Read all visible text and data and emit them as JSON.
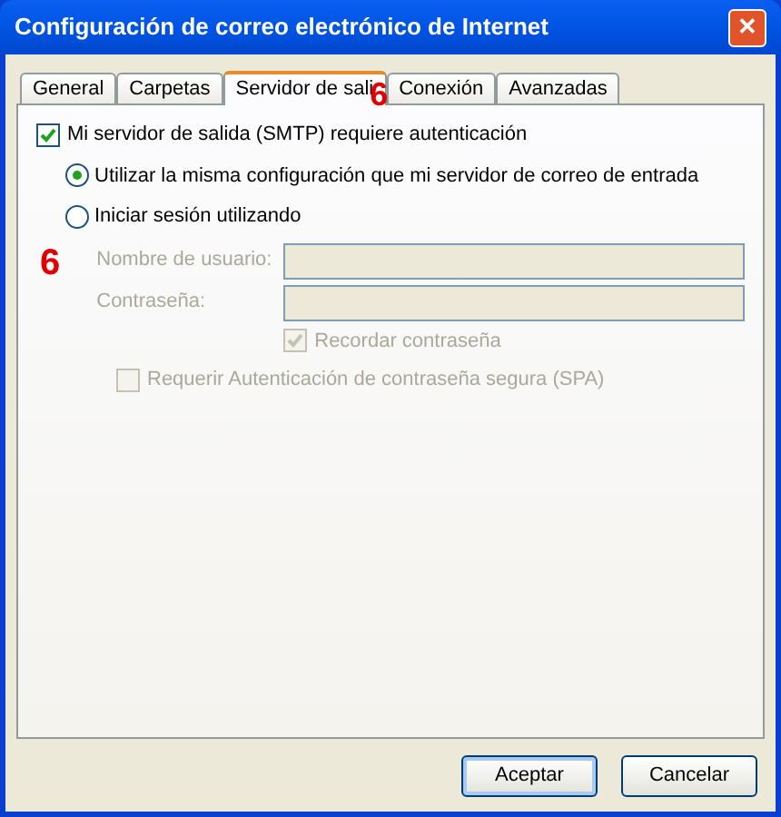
{
  "window": {
    "title": "Configuración de correo electrónico de Internet",
    "close": "✕"
  },
  "tabs": [
    {
      "label": "General",
      "selected": false
    },
    {
      "label": "Carpetas",
      "selected": false
    },
    {
      "label": "Servidor de sali",
      "selected": true,
      "annotation": "6"
    },
    {
      "label": "Conexión",
      "selected": false
    },
    {
      "label": "Avanzadas",
      "selected": false
    }
  ],
  "smtp_auth": {
    "label": "Mi servidor de salida (SMTP) requiere autenticación",
    "checked": true
  },
  "options": [
    {
      "label": "Utilizar la misma configuración que mi servidor de correo de entrada",
      "selected": true
    },
    {
      "label": "Iniciar sesión utilizando",
      "selected": false
    }
  ],
  "annotation": "6",
  "fields": [
    {
      "label": "Nombre de usuario:",
      "disabled": true
    },
    {
      "label": "Contraseña:",
      "disabled": true
    }
  ],
  "remember": {
    "label": "Recordar contraseña",
    "checked": true,
    "disabled": true
  },
  "spa": {
    "label": "Requerir Autenticación de contraseña segura (SPA)",
    "checked": false,
    "disabled": true
  },
  "buttons": [
    {
      "label": "Aceptar",
      "default": true
    },
    {
      "label": "Cancelar",
      "default": false
    }
  ]
}
